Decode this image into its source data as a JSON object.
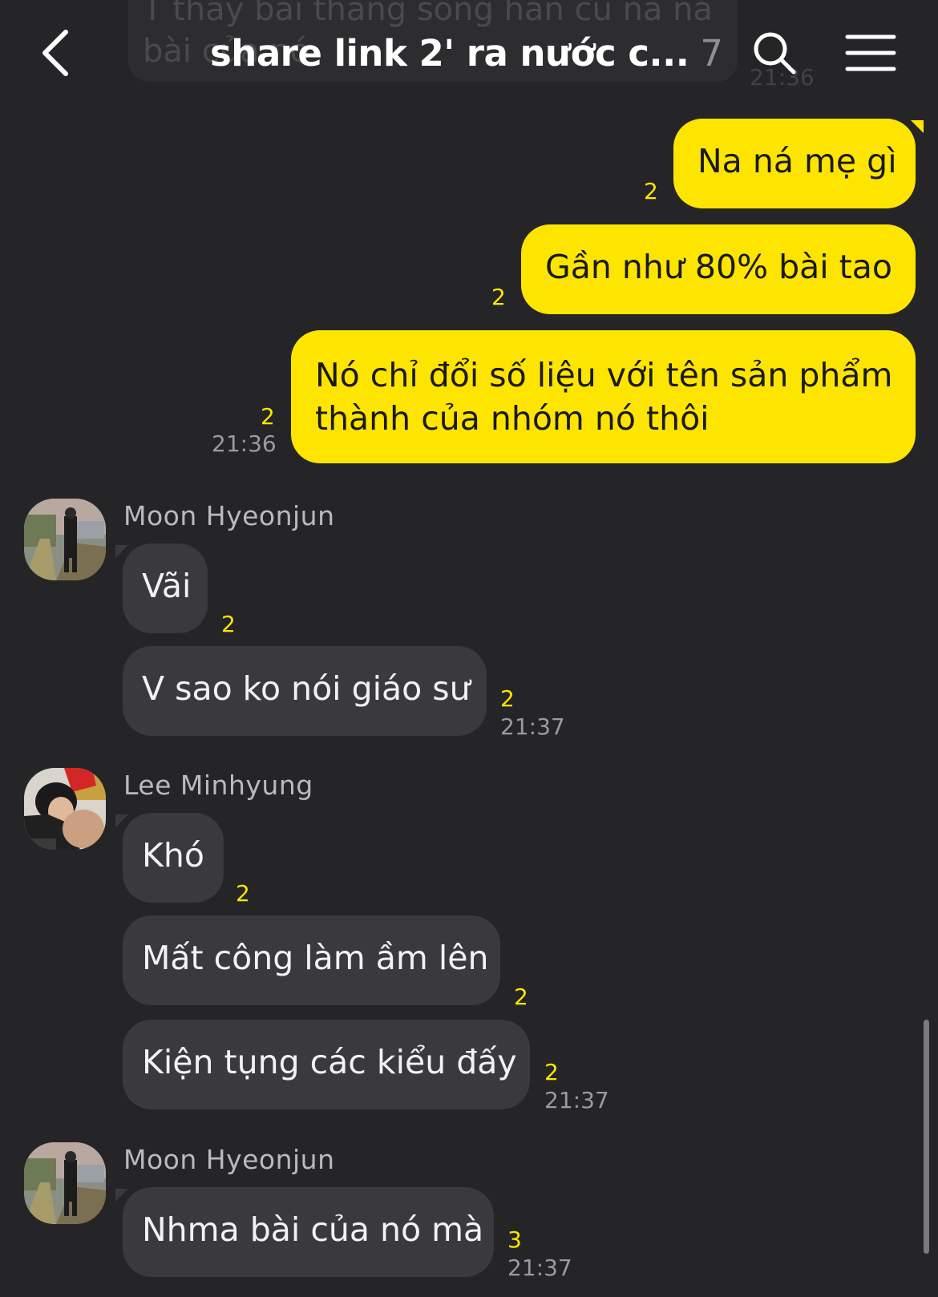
{
  "header": {
    "ghost_text": "T thấy bài thằng sống hàn cũ na ná bài của nó",
    "ghost_time": "21:36",
    "title": "share link 2' ra nước c...",
    "member_count": "7"
  },
  "icons": {
    "back": "chevron-left-icon",
    "search": "search-icon",
    "menu": "hamburger-menu-icon"
  },
  "colors": {
    "background": "#252528",
    "my_bubble": "#fee500",
    "other_bubble": "#3a3a3e",
    "unread": "#fee500"
  },
  "outgoing": [
    {
      "text": "Na ná mẹ gì",
      "unread": "2"
    },
    {
      "text": "Gần như 80% bài tao",
      "unread": "2"
    },
    {
      "text_line1": "Nó chỉ đổi số liệu với tên sản phẩm",
      "text_line2": "thành của nhóm nó thôi",
      "unread": "2",
      "time": "21:36"
    }
  ],
  "groups": [
    {
      "sender": "Moon Hyeonjun",
      "messages": [
        {
          "text": "Vãi",
          "unread": "2"
        },
        {
          "text": "V sao ko nói giáo sư",
          "unread": "2",
          "time": "21:37"
        }
      ]
    },
    {
      "sender": "Lee Minhyung",
      "messages": [
        {
          "text": "Khó",
          "unread": "2"
        },
        {
          "text": "Mất công làm ầm lên",
          "unread": "2"
        },
        {
          "text": "Kiện tụng các kiểu đấy",
          "unread": "2",
          "time": "21:37"
        }
      ]
    },
    {
      "sender": "Moon Hyeonjun",
      "messages": [
        {
          "text": "Nhma bài của nó mà",
          "unread": "3",
          "time": "21:37"
        }
      ]
    }
  ]
}
